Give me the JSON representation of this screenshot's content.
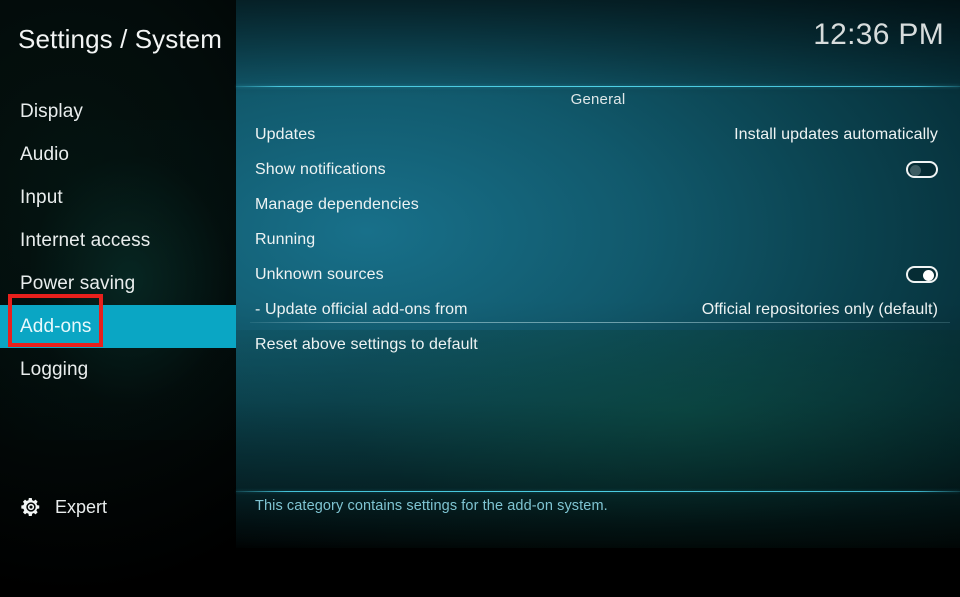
{
  "header": {
    "title": "Settings / System",
    "clock": "12:36 PM"
  },
  "sidebar": {
    "items": [
      {
        "label": "Display",
        "selected": false
      },
      {
        "label": "Audio",
        "selected": false
      },
      {
        "label": "Input",
        "selected": false
      },
      {
        "label": "Internet access",
        "selected": false
      },
      {
        "label": "Power saving",
        "selected": false
      },
      {
        "label": "Add-ons",
        "selected": true
      },
      {
        "label": "Logging",
        "selected": false
      }
    ],
    "level": {
      "icon": "gear-icon",
      "label": "Expert"
    }
  },
  "main": {
    "section_title": "General",
    "rows": [
      {
        "label": "Updates",
        "value": "Install updates automatically",
        "control": "text"
      },
      {
        "label": "Show notifications",
        "value": "",
        "control": "toggle",
        "toggle_state": "off"
      },
      {
        "label": "Manage dependencies",
        "value": "",
        "control": "none"
      },
      {
        "label": "Running",
        "value": "",
        "control": "none"
      },
      {
        "label": "Unknown sources",
        "value": "",
        "control": "toggle",
        "toggle_state": "on"
      },
      {
        "label": "- Update official add-ons from",
        "value": "Official repositories only (default)",
        "control": "text"
      }
    ],
    "reset_row": {
      "label": "Reset above settings to default",
      "value": "",
      "control": "none"
    },
    "description": "This category contains settings for the add-on system."
  },
  "annotation": {
    "target": "Add-ons",
    "color": "#e8201c"
  },
  "colors": {
    "highlight": "#0aa6c4",
    "separator": "#4ccee2",
    "description_text": "#7fc4d2",
    "panel_teal": "#11596c",
    "sidebar_dark": "#030c0b"
  }
}
